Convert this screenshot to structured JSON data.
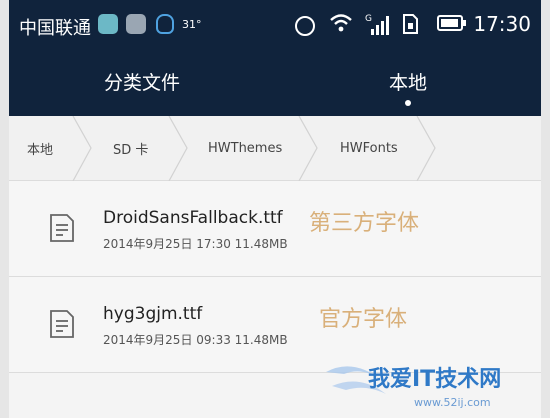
{
  "status_bar": {
    "carrier": "中国联通",
    "temperature": "31°",
    "time": "17:30",
    "signal_label": "G"
  },
  "tabs": [
    {
      "label": "分类文件",
      "active": false
    },
    {
      "label": "本地",
      "active": true
    }
  ],
  "breadcrumb": [
    "本地",
    "SD 卡",
    "HWThemes",
    "HWFonts"
  ],
  "files": [
    {
      "name": "DroidSansFallback.ttf",
      "meta": "2014年9月25日 17:30 11.48MB",
      "note": "第三方字体"
    },
    {
      "name": "hyg3gjm.ttf",
      "meta": "2014年9月25日 09:33 11.48MB",
      "note": "官方字体"
    }
  ],
  "watermark": {
    "title": "我爱IT技术网",
    "url": "www.52ij.com"
  },
  "colors": {
    "header": "#10233c",
    "note": "#d9b07a",
    "accent": "#4fa2e0"
  }
}
